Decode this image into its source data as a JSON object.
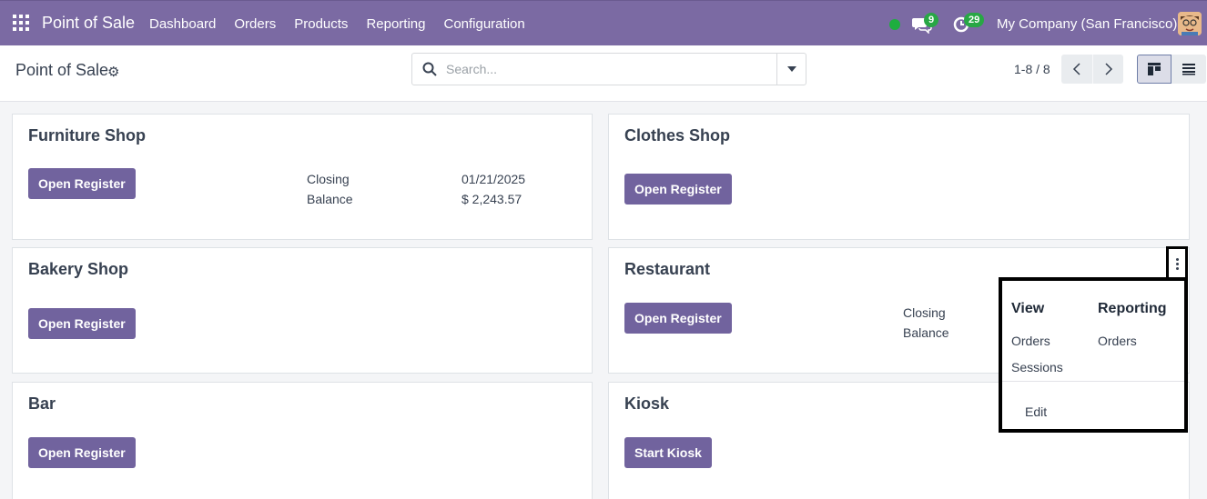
{
  "navbar": {
    "app_name": "Point of Sale",
    "menu": [
      "Dashboard",
      "Orders",
      "Products",
      "Reporting",
      "Configuration"
    ],
    "chat_badge": "9",
    "activity_badge": "29",
    "company": "My Company (San Francisco)",
    "status_color": "#1eae3f",
    "accent_color": "#7b6aa3"
  },
  "control_panel": {
    "title": "Point of Sale",
    "search_placeholder": "Search...",
    "pager": "1-8 / 8"
  },
  "cards": [
    {
      "name": "Furniture Shop",
      "button": "Open Register",
      "closing_label": "Closing",
      "balance_label": "Balance",
      "closing_date": "01/21/2025",
      "balance_value": "$ 2,243.57"
    },
    {
      "name": "Clothes Shop",
      "button": "Open Register"
    },
    {
      "name": "Bakery Shop",
      "button": "Open Register"
    },
    {
      "name": "Restaurant",
      "button": "Open Register",
      "closing_label": "Closing",
      "balance_label": "Balance"
    },
    {
      "name": "Bar",
      "button": "Open Register"
    },
    {
      "name": "Kiosk",
      "button": "Start Kiosk"
    }
  ],
  "dropdown": {
    "view_heading": "View",
    "view_items": [
      "Orders",
      "Sessions"
    ],
    "reporting_heading": "Reporting",
    "reporting_items": [
      "Orders"
    ],
    "edit_label": "Edit"
  }
}
